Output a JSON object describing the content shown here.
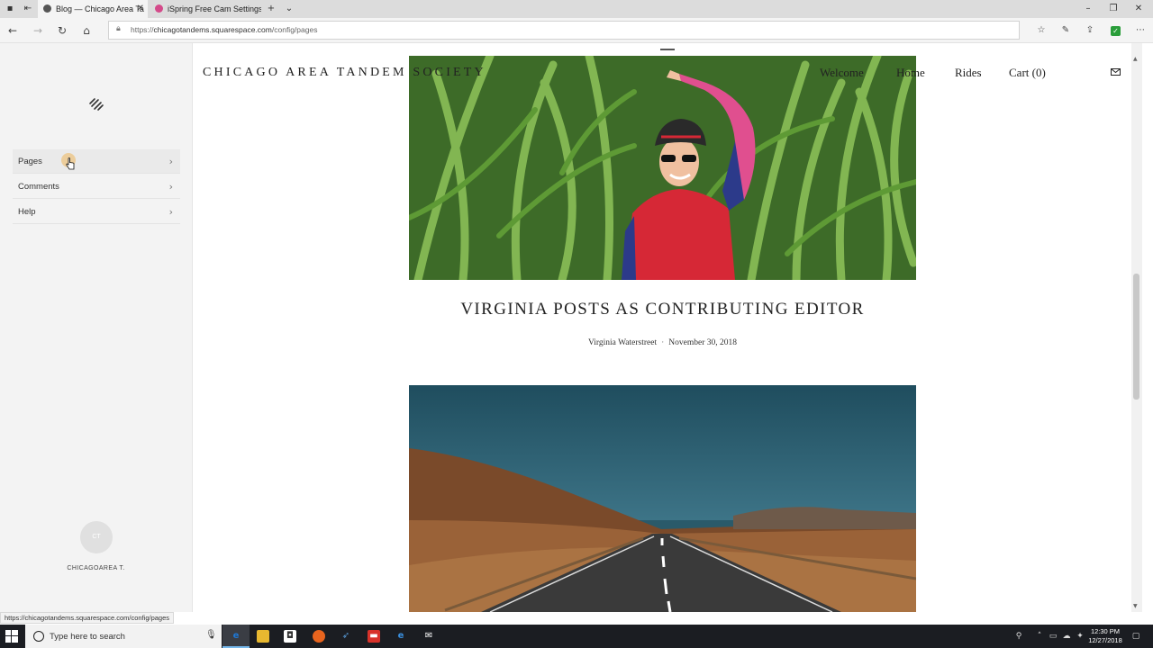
{
  "browser": {
    "tabs": [
      {
        "title": "Blog — Chicago Area Ta",
        "active": true
      },
      {
        "title": "iSpring Free Cam Settings -",
        "active": false
      }
    ],
    "url_prefix": "https://",
    "url_domain": "chicagotandems.squarespace.com",
    "url_path": "/config/pages",
    "status_url": "https://chicagotandems.squarespace.com/config/pages"
  },
  "sidebar": {
    "items": [
      {
        "label": "Pages"
      },
      {
        "label": "Comments"
      },
      {
        "label": "Help"
      }
    ],
    "avatar_initials": "CT",
    "user_name": "CHICAGOAREA T."
  },
  "site": {
    "title": "CHICAGO AREA TANDEM SOCIETY",
    "nav": {
      "welcome": "Welcome",
      "home": "Home",
      "rides": "Rides",
      "cart": "Cart (0)"
    },
    "post": {
      "title": "VIRGINIA POSTS AS CONTRIBUTING EDITOR",
      "author": "Virginia Waterstreet",
      "separator": "·",
      "date": "November 30, 2018"
    }
  },
  "taskbar": {
    "search_placeholder": "Type here to search",
    "time": "12:30 PM",
    "date": "12/27/2018"
  },
  "colors": {
    "panel_bg": "#f3f3f3",
    "taskbar_bg": "#1b1d22",
    "edge_blue": "#1e78d6",
    "corn_green": "#3f6f2a",
    "jersey_red": "#d62836",
    "sky_teal": "#2a5a6a",
    "desert_brown": "#7a4a2a"
  }
}
